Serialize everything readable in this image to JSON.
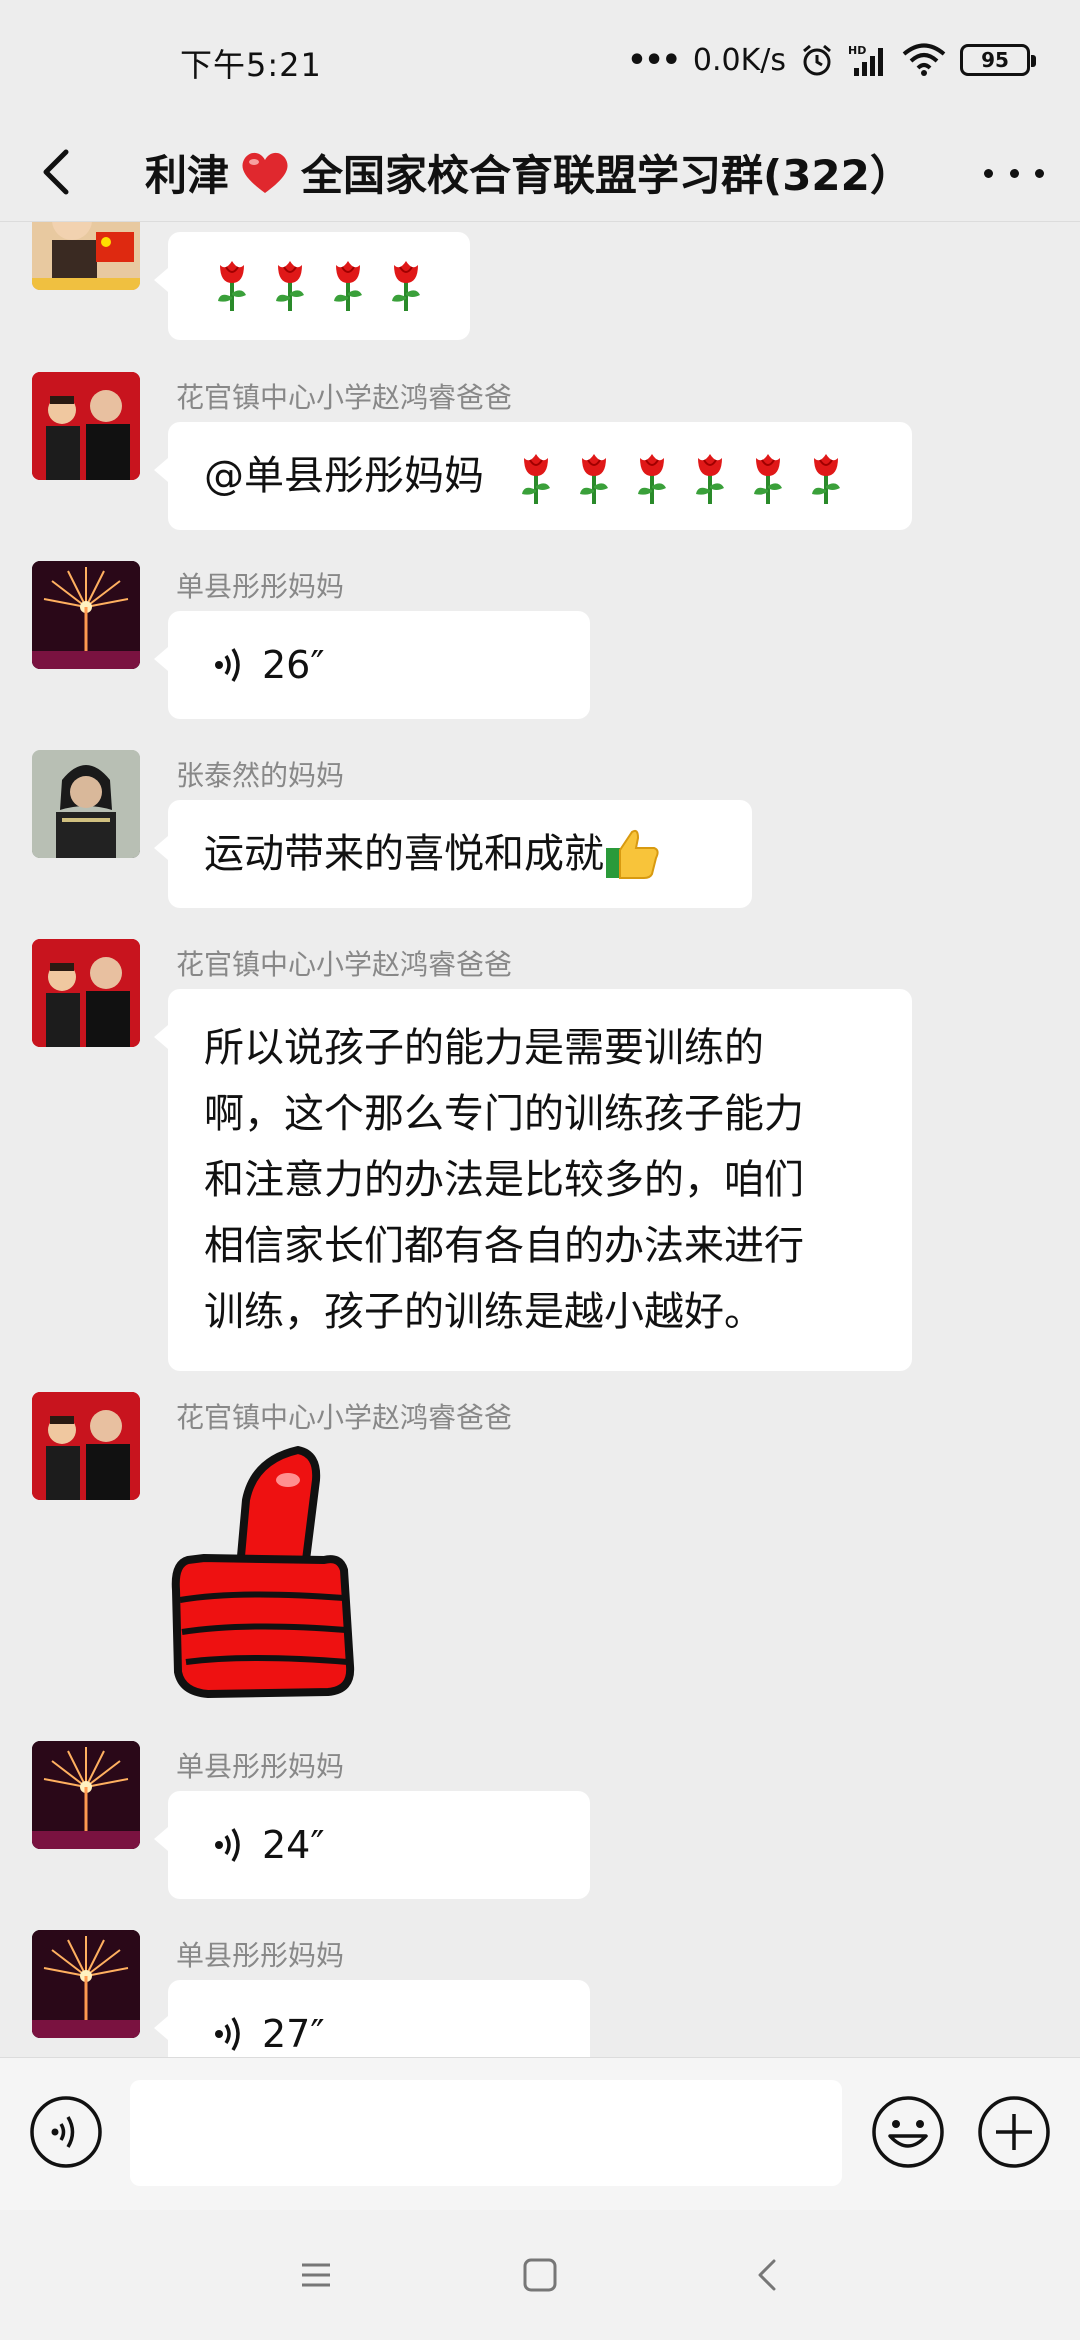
{
  "status_bar": {
    "time": "下午5:21",
    "net_speed": "0.0K/s",
    "battery": "95",
    "icons": [
      "alarm-icon",
      "signal-icon",
      "wifi-icon",
      "battery-icon"
    ]
  },
  "header": {
    "title_prefix": "利津",
    "title_suffix": "全国家校合育联盟学习群(322）",
    "heart_color": "#e0282e"
  },
  "messages": [
    {
      "sender": "",
      "type": "emoji",
      "text": "",
      "roses": 4
    },
    {
      "sender": "花官镇中心小学赵鸿睿爸爸",
      "type": "text",
      "text": "@单县彤彤妈妈",
      "roses": 6
    },
    {
      "sender": "单县彤彤妈妈",
      "type": "voice",
      "duration": "26″"
    },
    {
      "sender": "张泰然的妈妈",
      "type": "text",
      "text": "运动带来的喜悦和成就"
    },
    {
      "sender": "花官镇中心小学赵鸿睿爸爸",
      "type": "text",
      "lines": [
        "所以说孩子的能力是需要训练的",
        "啊，这个那么专门的训练孩子能力",
        "和注意力的办法是比较多的，咱们",
        "相信家长们都有各自的办法来进行",
        "训练，孩子的训练是越小越好。"
      ]
    },
    {
      "sender": "花官镇中心小学赵鸿睿爸爸",
      "type": "sticker",
      "sticker": "thumbs-up"
    },
    {
      "sender": "单县彤彤妈妈",
      "type": "voice",
      "duration": "24″"
    },
    {
      "sender": "单县彤彤妈妈",
      "type": "voice",
      "duration": "27″"
    }
  ],
  "input": {
    "placeholder": ""
  },
  "colors": {
    "background": "#ededed",
    "bubble": "#ffffff",
    "sender": "#888888"
  }
}
